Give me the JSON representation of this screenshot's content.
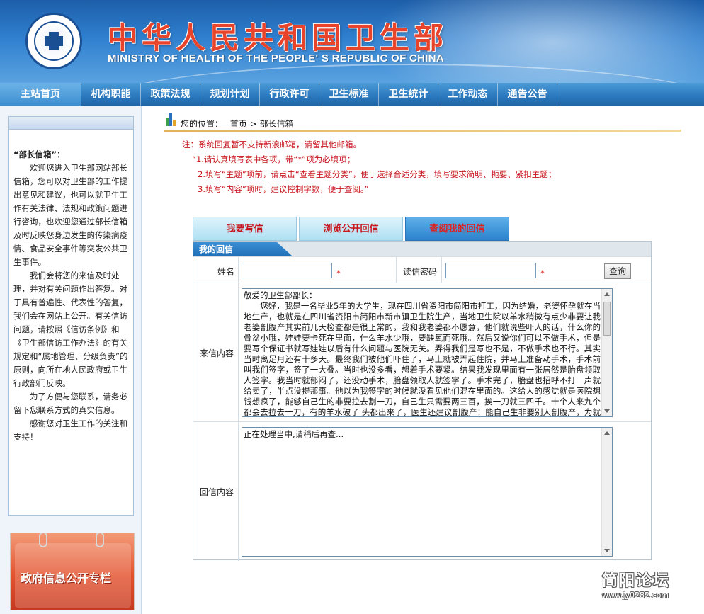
{
  "header": {
    "title_cn": "中华人民共和国卫生部",
    "title_en": "MINISTRY OF HEALTH OF THE PEOPLE' S REPUBLIC OF CHINA",
    "emblem_icon": "ministry-emblem-icon"
  },
  "nav": {
    "items": [
      "主站首页",
      "机构职能",
      "政策法规",
      "规划计划",
      "行政许可",
      "卫生标准",
      "卫生统计",
      "工作动态",
      "通告公告"
    ]
  },
  "sidebar": {
    "intro_title": "“部长信箱”：",
    "para1": "欢迎您进入卫生部网站部长信箱，您可以对卫生部的工作提出意见和建议，也可以就卫生工作有关法律、法规和政策问题进行咨询，也欢迎您通过部长信箱及时反映您身边发生的传染病疫情、食品安全事件等突发公共卫生事件。",
    "para2": "我们会将您的来信及时处理，并对有关问题作出答复。对于具有普遍性、代表性的答复，我们会在网站上公开。有关信访问题，请按照《信访条例》和《卫生部信访工作办法》的有关规定和“属地管理、分级负责”的原则，向所在地人民政府或卫生行政部门反映。",
    "para3": "为了方便与您联系，请务必留下您联系方式的真实信息。",
    "para4": "感谢您对卫生工作的关注和支持！",
    "banner_label": "政府信息公开专栏"
  },
  "location": {
    "label": "您的位置：",
    "home": "首页",
    "separator": " > ",
    "current": "部长信箱"
  },
  "notes": {
    "line1": "注：系统回复暂不支持新浪邮箱，请留其他邮箱。",
    "line2": "“1.请认真填写表中各项，带“*”项为必填项；",
    "line3": "2.填写“主题”项前，请点击“查看主题分类”，便于选择合适分类，填写要求简明、扼要、紧扣主题；",
    "line4": "3.填写“内容”项时，建议控制字数，便于查阅。”"
  },
  "tabs": [
    {
      "label": "我要写信",
      "active": false
    },
    {
      "label": "浏览公开回信",
      "active": false
    },
    {
      "label": "查阅我的回信",
      "active": true
    }
  ],
  "form": {
    "section_title": "我的回信",
    "name_label": "姓名",
    "name_value": "",
    "password_label": "读信密码",
    "password_value": "",
    "required_mark": "*",
    "query_button": "查询",
    "letter_label": "来信内容",
    "letter_text": "敬爱的卫生部部长：\n　　您好，我是一名毕业5年的大学生，现在四川省资阳市简阳市打工，因为结婚，老婆怀孕就在当地生产，也就是在四川省资阳市简阳市新市镇卫生院生产，当地卫生院以羊水稍微有点少非要让我老婆剖腹产其实前几天检查都是很正常的，我和我老婆都不愿意，他们就说些吓人的话，什么你的骨盆小哦，娃娃要卡死在里面，什么羊水少哦，要缺氧而死哦。然后又说你们可以不做手术，但是要写个保证书就写娃娃以后有什么问题与医院无关。弄得我们是写也不是，不做手术也不行。其实当时离足月还有十多天。最终我们被他们吓住了，马上就被弄起住院，并马上准备动手术，手术前叫我们签字，签了一大叠。当时也没多看，想着手术要紧。结果我发现里面有一张居然是胎盘领取人签字。我当时就郁闷了，还没动手术，胎盘领取人就签字了。手术完了，胎盘也招呼不打一声就给卖了，半点没提那事。他以为我签字的时候就没看见他们混在里面的。这给人的感觉就是医院想钱想疯了，能够自己生的非要拉去割一刀，自己生只需要两三百，挨一刀就三四千。十个人来九个都会去拉去一刀，有的羊水破了 头都出来了，医生还建议剖腹产！能自己生非要别人剖腹产，为就多挣几千块黑心钱，动手术前就把胎盘领",
    "reply_label": "回信内容",
    "reply_text": "正在处理当中,请稍后再查..."
  },
  "watermark": {
    "line1": "简阳论坛",
    "line2": "www.jy0282.com"
  },
  "colors": {
    "accent_red": "#c8141d",
    "nav_blue": "#2b78bd",
    "tab_active": "#2b82cd"
  }
}
